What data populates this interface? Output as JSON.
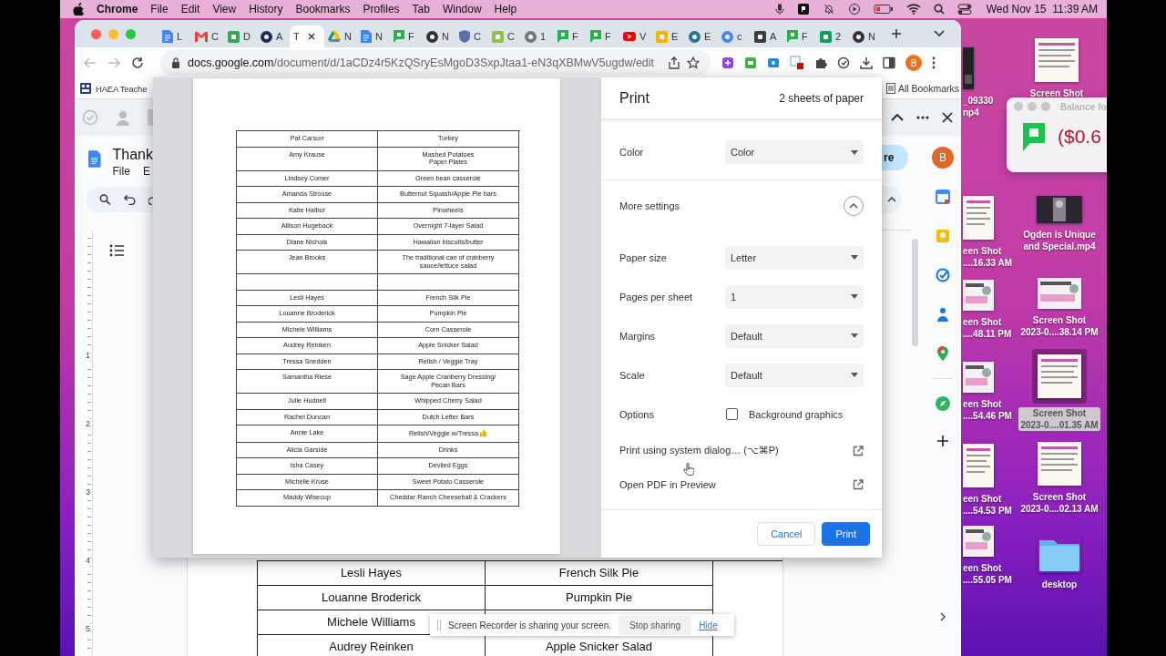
{
  "menubar": {
    "app": "Chrome",
    "menus": [
      "File",
      "Edit",
      "View",
      "History",
      "Bookmarks",
      "Profiles",
      "Tab",
      "Window",
      "Help"
    ],
    "clock": "Wed Nov 15  11:39 AM"
  },
  "desktop": {
    "icons": [
      {
        "kind": "doc",
        "lines": [
          "Screen Shot"
        ],
        "selected": false
      },
      {
        "kind": "dark",
        "lines": [
          "_09330",
          "np4"
        ],
        "selected": false
      },
      {
        "kind": "doc",
        "lines": [
          "een Shot",
          "....16.33 AM"
        ],
        "selected": false
      },
      {
        "kind": "slide",
        "lines": [
          "een Shot",
          "....48.11 PM"
        ],
        "selected": false
      },
      {
        "kind": "slide",
        "lines": [
          "een Shot",
          "....54.46 PM"
        ],
        "selected": false
      },
      {
        "kind": "doc",
        "lines": [
          "een Shot",
          "....54.53 PM"
        ],
        "selected": false
      },
      {
        "kind": "slide",
        "lines": [
          "een Shot",
          "....55.05 PM"
        ],
        "selected": false
      },
      {
        "kind": "video",
        "lines": [
          "Ogden is Unique",
          "and Special.mp4"
        ],
        "selected": false
      },
      {
        "kind": "slide",
        "lines": [
          "Screen Shot",
          "2023-0....38.14 PM"
        ],
        "selected": false
      },
      {
        "kind": "doc",
        "lines": [
          "Screen Shot",
          "2023-0....01.35 AM"
        ],
        "selected": true
      },
      {
        "kind": "doc",
        "lines": [
          "Screen Shot",
          "2023-0....02.13 AM"
        ],
        "selected": false
      },
      {
        "kind": "folder",
        "lines": [
          "desktop"
        ],
        "selected": false
      }
    ]
  },
  "balance_widget": {
    "title": "Balance fo",
    "amount": "($0.6"
  },
  "browser": {
    "tabs": [
      {
        "label": "L",
        "kind": "doc",
        "color": "#4285f4",
        "selected": false
      },
      {
        "label": "C",
        "kind": "mail",
        "color": "#ea4335",
        "selected": false
      },
      {
        "label": "D",
        "kind": "square",
        "color": "#34a853",
        "selected": false
      },
      {
        "label": "A",
        "kind": "circle",
        "color": "#1f2a5a",
        "selected": false
      },
      {
        "label": "T",
        "kind": "plain",
        "selected": true
      },
      {
        "label": "N",
        "kind": "triangle",
        "color": "#fbbc04",
        "selected": false
      },
      {
        "label": "N",
        "kind": "doc",
        "color": "#4285f4",
        "selected": false
      },
      {
        "label": "F",
        "kind": "flag",
        "color": "#22b14c",
        "selected": false
      },
      {
        "label": "N",
        "kind": "circle",
        "color": "#333333",
        "selected": false
      },
      {
        "label": "C",
        "kind": "shield",
        "color": "#5b6fa8",
        "selected": false
      },
      {
        "label": "C",
        "kind": "square",
        "color": "#8bc34a",
        "selected": false
      },
      {
        "label": "1",
        "kind": "circle",
        "color": "#777777",
        "selected": false
      },
      {
        "label": "F",
        "kind": "flag",
        "color": "#22b14c",
        "selected": false
      },
      {
        "label": "F",
        "kind": "flag",
        "color": "#22b14c",
        "selected": false
      },
      {
        "label": "V",
        "kind": "play",
        "color": "#ff0000",
        "selected": false
      },
      {
        "label": "E",
        "kind": "square",
        "color": "#f4b400",
        "selected": false
      },
      {
        "label": "E",
        "kind": "circle",
        "color": "#21759b",
        "selected": false
      },
      {
        "label": "c",
        "kind": "circle",
        "color": "#4285f4",
        "selected": false
      },
      {
        "label": "A",
        "kind": "square",
        "color": "#3c3c3c",
        "selected": false
      },
      {
        "label": "F",
        "kind": "flag",
        "color": "#22b14c",
        "selected": false
      },
      {
        "label": "2",
        "kind": "square",
        "color": "#0f9d58",
        "selected": false
      },
      {
        "label": "N",
        "kind": "circle",
        "color": "#333333",
        "selected": false
      }
    ],
    "url": "docs.google.com/document/d/1aCDz4r5KzQSryEsMgoD3SxpJtaa1-eN3qXBMwV5ugdw/edit",
    "profile": "B",
    "bookmarks": [
      "HAEA Teache"
    ],
    "all_bookmarks": "All Bookmarks"
  },
  "docs": {
    "title": "Thank",
    "menus": [
      "File",
      "E"
    ],
    "share": "re",
    "avatar": "B",
    "ruler": [
      "1",
      "2",
      "3",
      "4",
      "5"
    ],
    "table": [
      {
        "name": "Lesli Hayes",
        "item": "French Silk Pie"
      },
      {
        "name": "Louanne Broderick",
        "item": "Pumpkin Pie"
      },
      {
        "name": "Michele Williams"
      },
      {
        "name": "Audrey Reinken",
        "item": "Apple Snicker Salad"
      }
    ]
  },
  "print_dialog": {
    "title": "Print",
    "sheets": "2 sheets of paper",
    "preview_rows": [
      {
        "kind": "entry",
        "name": "Pat Carson",
        "item": "Turkey"
      },
      {
        "kind": "entry",
        "name": "Amy Krause",
        "item": "Mashed Potatoes\nPaper Plates"
      },
      {
        "kind": "entry",
        "name": "Lindsey Comer",
        "item": "Green bean casserole"
      },
      {
        "kind": "entry",
        "name": "Amanda Strouse",
        "item": "Butternut Squash/Apple Pie bars"
      },
      {
        "kind": "entry",
        "name": "Katie Halbur",
        "item": "Pinwheels"
      },
      {
        "kind": "entry",
        "name": "Allison Hugeback",
        "item": "Overnight 7-layer Salad"
      },
      {
        "kind": "entry",
        "name": "Diane Nichols",
        "item": "Hawaiian biscuits/butter"
      },
      {
        "kind": "entry",
        "name": "Jean Brooks",
        "item": "The traditional can of cranberry\nsauce/lettuce salad"
      },
      {
        "kind": "blank"
      },
      {
        "kind": "entry",
        "name": "Lesli Hayes",
        "item": "French Silk Pie"
      },
      {
        "kind": "entry",
        "name": "Louanne Broderick",
        "item": "Pumpkin Pie"
      },
      {
        "kind": "entry",
        "name": "Michele Williams",
        "item": "Corn Casserole"
      },
      {
        "kind": "entry",
        "name": "Audrey Reinken",
        "item": "Apple Snicker Salad"
      },
      {
        "kind": "entry",
        "name": "Tressa Snedden",
        "item": "Relish / Veggie Tray"
      },
      {
        "kind": "entry",
        "name": "Samantha Riese",
        "item": "Sage Apple Cranberry Dressing/\nPecan Bars"
      },
      {
        "kind": "entry",
        "name": "Julie Hudnell",
        "item": "Whipped Cherry Salad"
      },
      {
        "kind": "entry",
        "name": "Rachel Duncan",
        "item": "Dutch Letter Bars"
      },
      {
        "kind": "thumbsup",
        "name": "Annie Lake",
        "item": "Relish/Veggie w/Tressa"
      },
      {
        "kind": "entry",
        "name": "Alicia Garside",
        "item": "Drinks"
      },
      {
        "kind": "entry",
        "name": "Isha Casey",
        "item": "Deviled Eggs"
      },
      {
        "kind": "entry",
        "name": "Michelle Kruse",
        "item": "Sweet Potato Casserole"
      },
      {
        "kind": "entry",
        "name": "Maddy Wisecup",
        "item": "Cheddar Ranch Cheeseball & Crackers"
      }
    ],
    "settings": [
      {
        "kind": "select",
        "label": "Color",
        "value": "Color"
      },
      {
        "kind": "expander",
        "label": "More settings",
        "expanded": true
      },
      {
        "kind": "select",
        "label": "Paper size",
        "value": "Letter"
      },
      {
        "kind": "select",
        "label": "Pages per sheet",
        "value": "1"
      },
      {
        "kind": "select",
        "label": "Margins",
        "value": "Default"
      },
      {
        "kind": "select",
        "label": "Scale",
        "value": "Default"
      },
      {
        "kind": "checkbox",
        "label": "Options",
        "option": "Background graphics",
        "checked": false
      },
      {
        "kind": "link",
        "label": "Print using system dialog… (⌥⌘P)"
      },
      {
        "kind": "link",
        "label": "Open PDF in Preview"
      }
    ],
    "buttons": [
      {
        "label": "Cancel",
        "kind": "secondary"
      },
      {
        "label": "Print",
        "kind": "primary"
      }
    ]
  },
  "recorder_bar": {
    "message": "Screen Recorder is sharing your screen.",
    "stop": "Stop sharing",
    "hide": "Hide"
  }
}
